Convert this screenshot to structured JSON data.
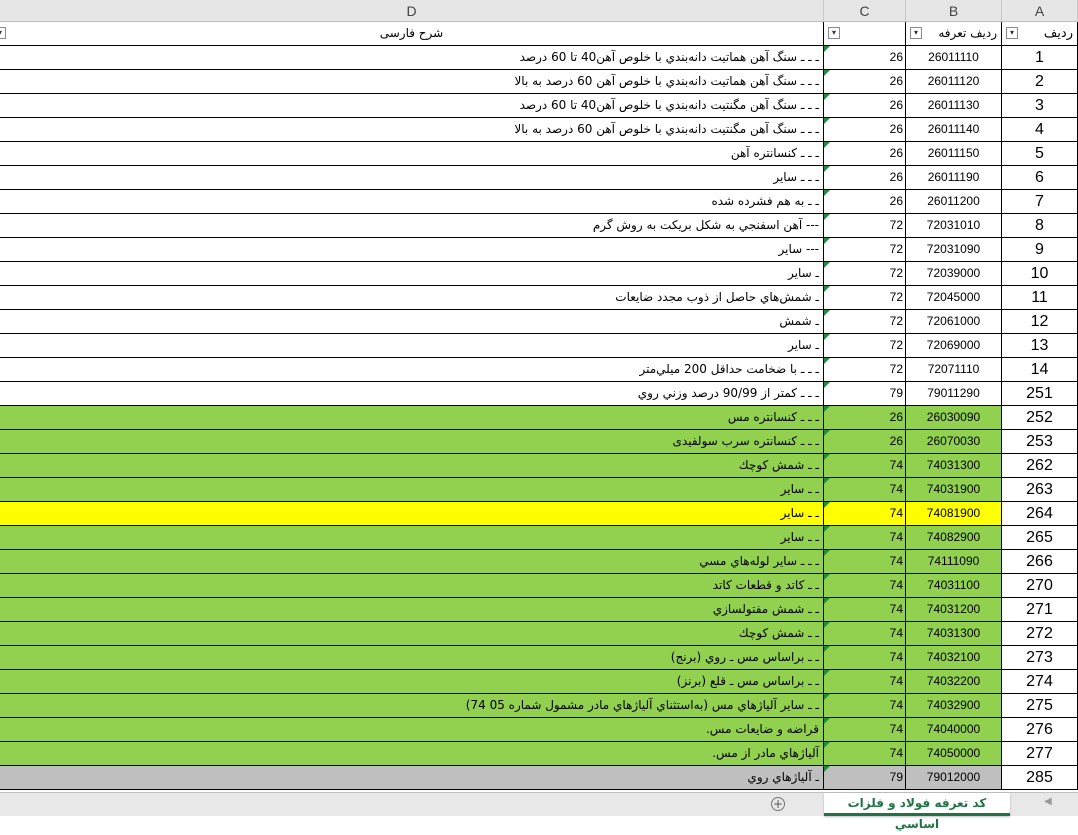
{
  "columns": {
    "D": "D",
    "C": "C",
    "B": "B",
    "A": "A"
  },
  "header": {
    "d_label": "شرح فارسی",
    "c_label": "",
    "b_label": "رديف تعرفه",
    "a_label": "رديف"
  },
  "rows": [
    {
      "a": "1",
      "b": "26011110",
      "c": "26",
      "d": "ـ ـ ـ سنگ آهن هماتيت دانه‌بندي با خلوص آهن40 تا 60 درصد",
      "fill": "#ffffff"
    },
    {
      "a": "2",
      "b": "26011120",
      "c": "26",
      "d": "ـ ـ ـ سنگ آهن هماتيت دانه‌بندي با خلوص آهن 60 درصد به بالا",
      "fill": "#ffffff"
    },
    {
      "a": "3",
      "b": "26011130",
      "c": "26",
      "d": "ـ ـ ـ سنگ آهن مگنتيت دانه‌بندي با خلوص آهن40 تا 60 درصد",
      "fill": "#ffffff"
    },
    {
      "a": "4",
      "b": "26011140",
      "c": "26",
      "d": "ـ ـ ـ سنگ آهن مگنتيت دانه‌بندي با خلوص آهن 60 درصد به بالا",
      "fill": "#ffffff"
    },
    {
      "a": "5",
      "b": "26011150",
      "c": "26",
      "d": "ـ ـ ـ كنسانتره آهن",
      "fill": "#ffffff"
    },
    {
      "a": "6",
      "b": "26011190",
      "c": "26",
      "d": "ـ ـ ـ ساير",
      "fill": "#ffffff"
    },
    {
      "a": "7",
      "b": "26011200",
      "c": "26",
      "d": "ـ ـ به هم فشرده شده",
      "fill": "#ffffff"
    },
    {
      "a": "8",
      "b": "72031010",
      "c": "72",
      "d": "--- آهن اسفنجي به شكل بريكت به روش گرم",
      "fill": "#ffffff"
    },
    {
      "a": "9",
      "b": "72031090",
      "c": "72",
      "d": "--- ساير",
      "fill": "#ffffff"
    },
    {
      "a": "10",
      "b": "72039000",
      "c": "72",
      "d": "ـ ساير",
      "fill": "#ffffff"
    },
    {
      "a": "11",
      "b": "72045000",
      "c": "72",
      "d": "ـ شمش‌هاي حاصل از ذوب مجدد ضايعات",
      "fill": "#ffffff"
    },
    {
      "a": "12",
      "b": "72061000",
      "c": "72",
      "d": "ـ شمش",
      "fill": "#ffffff"
    },
    {
      "a": "13",
      "b": "72069000",
      "c": "72",
      "d": "ـ ساير",
      "fill": "#ffffff"
    },
    {
      "a": "14",
      "b": "72071110",
      "c": "72",
      "d": "ـ ـ ـ با ضخامت حداقل 200 ميلي‌متر",
      "fill": "#ffffff"
    },
    {
      "a": "251",
      "b": "79011290",
      "c": "79",
      "d": "ـ ـ ـ كمتر از 90/99 درصد وزني روي",
      "fill": "#ffffff"
    },
    {
      "a": "252",
      "b": "26030090",
      "c": "26",
      "d": "ـ ـ ـ كنسانتره مس",
      "fill": "#92d050"
    },
    {
      "a": "253",
      "b": "26070030",
      "c": "26",
      "d": "ـ ـ ـ كنسانتره  سرب سولفيدی",
      "fill": "#92d050"
    },
    {
      "a": "262",
      "b": "74031300",
      "c": "74",
      "d": "ـ ـ شمش كوچك",
      "fill": "#92d050"
    },
    {
      "a": "263",
      "b": "74031900",
      "c": "74",
      "d": "ـ ـ ساير",
      "fill": "#92d050"
    },
    {
      "a": "264",
      "b": "74081900",
      "c": "74",
      "d": "ـ ـ ساير",
      "fill": "#ffff00"
    },
    {
      "a": "265",
      "b": "74082900",
      "c": "74",
      "d": "ـ ـ ساير",
      "fill": "#92d050"
    },
    {
      "a": "266",
      "b": "74111090",
      "c": "74",
      "d": "ـ ـ ـ ساير لوله‌هاي مسي",
      "fill": "#92d050"
    },
    {
      "a": "270",
      "b": "74031100",
      "c": "74",
      "d": "ـ ـ كاتد و قطعات كاتد",
      "fill": "#92d050"
    },
    {
      "a": "271",
      "b": "74031200",
      "c": "74",
      "d": "ـ ـ شمش مفتولسازي",
      "fill": "#92d050"
    },
    {
      "a": "272",
      "b": "74031300",
      "c": "74",
      "d": "ـ ـ شمش كوچك",
      "fill": "#92d050"
    },
    {
      "a": "273",
      "b": "74032100",
      "c": "74",
      "d": "ـ ـ براساس مس ـ روي (برنج)",
      "fill": "#92d050"
    },
    {
      "a": "274",
      "b": "74032200",
      "c": "74",
      "d": "ـ ـ براساس مس ـ قلع (برنز)",
      "fill": "#92d050"
    },
    {
      "a": "275",
      "b": "74032900",
      "c": "74",
      "d": "ـ ـ ساير آلياژهاي مس (به‌استثناي آلياژهاي مادر مشمول شماره 05  74)",
      "fill": "#92d050"
    },
    {
      "a": "276",
      "b": "74040000",
      "c": "74",
      "d": "قراضه و ضايعات مس.",
      "fill": "#92d050"
    },
    {
      "a": "277",
      "b": "74050000",
      "c": "74",
      "d": "آلياژهاي مادر از مس.",
      "fill": "#92d050"
    },
    {
      "a": "285",
      "b": "79012000",
      "c": "79",
      "d": "ـ آلياژهاي روي",
      "fill": "#bfbfbf"
    }
  ],
  "tabs": {
    "active": "كد تعرفه فولاد و فلزات اساسي",
    "add_label": "+"
  },
  "icons": {
    "filter": "filter-dropdown-icon",
    "add": "add-sheet-icon",
    "scroll": "scroll-right-icon"
  }
}
